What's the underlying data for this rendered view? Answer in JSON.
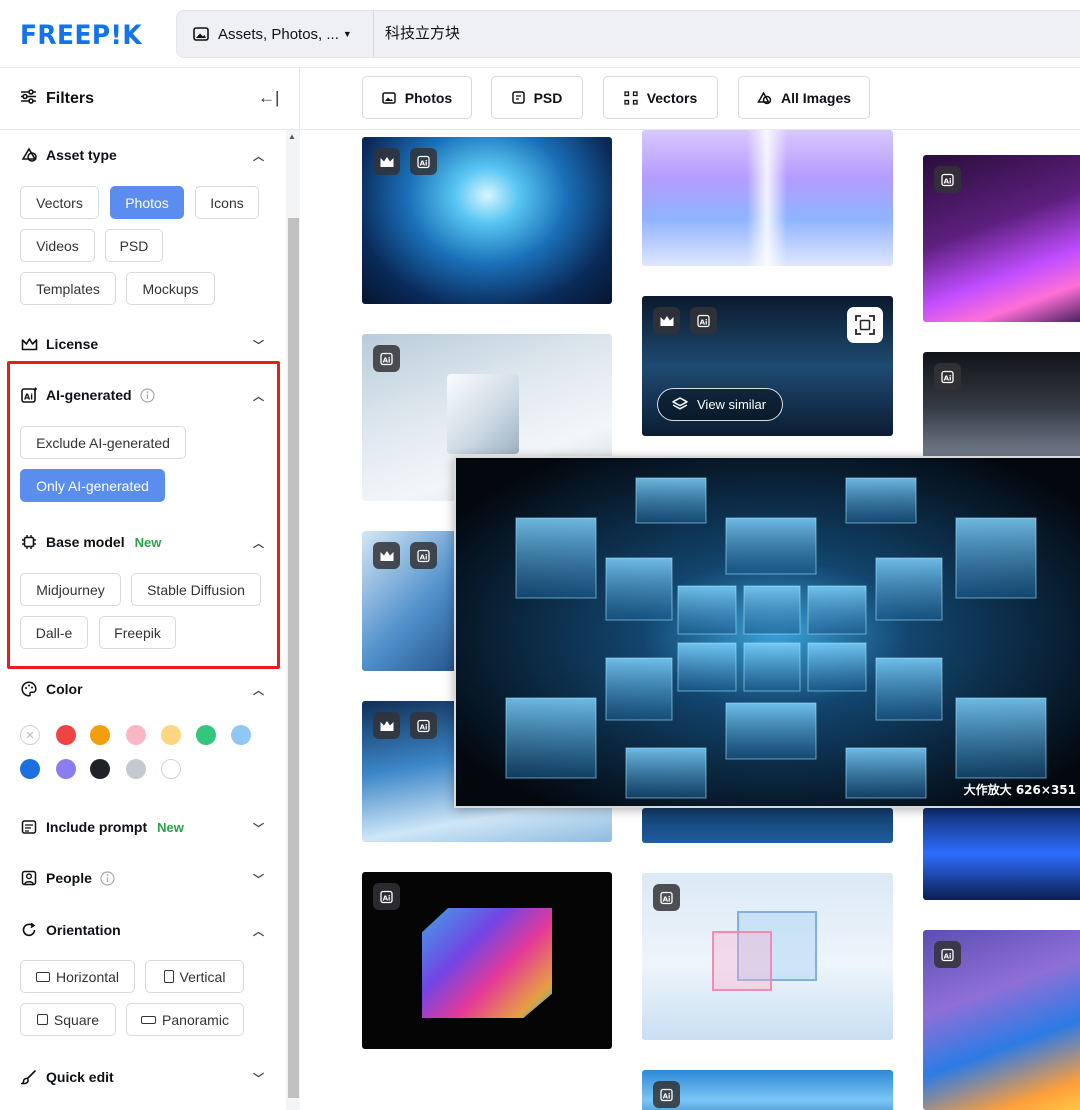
{
  "header": {
    "logo_text": "FREEP!K",
    "search_type": "Assets, Photos, ...",
    "search_query": "科技立方块"
  },
  "sidebar": {
    "title": "Filters",
    "asset_type": {
      "label": "Asset type",
      "options": [
        "Vectors",
        "Photos",
        "Icons",
        "Videos",
        "PSD",
        "Templates",
        "Mockups"
      ],
      "selected": "Photos"
    },
    "license": {
      "label": "License"
    },
    "ai_generated": {
      "label": "AI-generated",
      "options": [
        "Exclude AI-generated",
        "Only AI-generated"
      ],
      "selected": "Only AI-generated"
    },
    "base_model": {
      "label": "Base model",
      "new_tag": "New",
      "options": [
        "Midjourney",
        "Stable Diffusion",
        "Dall-e",
        "Freepik"
      ]
    },
    "color": {
      "label": "Color",
      "swatches": [
        "#ef4444",
        "#f59e0b",
        "#fbb6c6",
        "#fcd77f",
        "#34c77b",
        "#90c8f5",
        "#1d6fe0",
        "#8b7cf0",
        "#1f2329",
        "#c3c9d1",
        "#ffffff"
      ]
    },
    "include_prompt": {
      "label": "Include prompt",
      "new_tag": "New"
    },
    "people": {
      "label": "People"
    },
    "orientation": {
      "label": "Orientation",
      "options": [
        "Horizontal",
        "Vertical",
        "Square",
        "Panoramic"
      ]
    },
    "quick_edit": {
      "label": "Quick edit"
    }
  },
  "main": {
    "tabs": [
      "Photos",
      "PSD",
      "Vectors",
      "All Images"
    ],
    "view_similar": "View similar",
    "zoom_caption": "大作放大 626×351"
  },
  "colors": {
    "brand": "#1273eb",
    "active_chip": "#5b8def",
    "highlight": "#e61e1e",
    "new_tag": "#2aa24a"
  }
}
